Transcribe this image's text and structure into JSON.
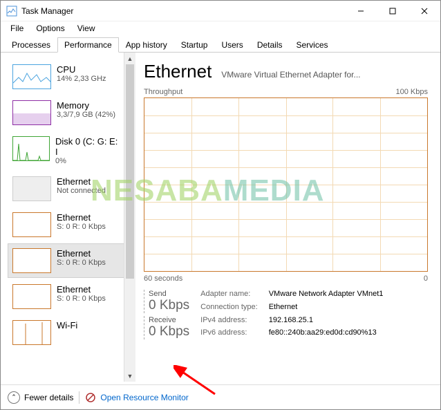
{
  "window": {
    "title": "Task Manager"
  },
  "menu": {
    "file": "File",
    "options": "Options",
    "view": "View"
  },
  "tabs": {
    "processes": "Processes",
    "performance": "Performance",
    "apphistory": "App history",
    "startup": "Startup",
    "users": "Users",
    "details": "Details",
    "services": "Services"
  },
  "sidebar": {
    "items": [
      {
        "title": "CPU",
        "sub": "14% 2,33 GHz",
        "color": "#4aa3df"
      },
      {
        "title": "Memory",
        "sub": "3,3/7,9 GB (42%)",
        "color": "#8e2ea5"
      },
      {
        "title": "Disk 0 (C: G: E: I",
        "sub": "0%",
        "color": "#3fa535"
      },
      {
        "title": "Ethernet",
        "sub": "Not connected",
        "color": "#bbbbbb"
      },
      {
        "title": "Ethernet",
        "sub": "S: 0 R: 0 Kbps",
        "color": "#c9772b"
      },
      {
        "title": "Ethernet",
        "sub": "S: 0 R: 0 Kbps",
        "color": "#c9772b"
      },
      {
        "title": "Ethernet",
        "sub": "S: 0 R: 0 Kbps",
        "color": "#c9772b"
      },
      {
        "title": "Wi-Fi",
        "sub": "",
        "color": "#c9772b"
      }
    ]
  },
  "main": {
    "title": "Ethernet",
    "subtitle": "VMware Virtual Ethernet Adapter for...",
    "chart_top_left": "Throughput",
    "chart_top_right": "100 Kbps",
    "chart_bottom_left": "60 seconds",
    "chart_bottom_right": "0",
    "send_label": "Send",
    "send_value": "0 Kbps",
    "receive_label": "Receive",
    "receive_value": "0 Kbps",
    "info": {
      "adapter_k": "Adapter name:",
      "adapter_v": "VMware Network Adapter VMnet1",
      "conn_k": "Connection type:",
      "conn_v": "Ethernet",
      "ipv4_k": "IPv4 address:",
      "ipv4_v": "192.168.25.1",
      "ipv6_k": "IPv6 address:",
      "ipv6_v": "fe80::240b:aa29:ed0d:cd90%13"
    }
  },
  "footer": {
    "fewer": "Fewer details",
    "orm": "Open Resource Monitor"
  },
  "chart_data": {
    "type": "line",
    "title": "Throughput",
    "series": [
      {
        "name": "Send",
        "values": [
          0,
          0,
          0,
          0,
          0,
          0,
          0,
          0,
          0,
          0,
          0,
          0
        ]
      },
      {
        "name": "Receive",
        "values": [
          0,
          0,
          0,
          0,
          0,
          0,
          0,
          0,
          0,
          0,
          0,
          0
        ]
      }
    ],
    "xlabel": "60 seconds",
    "ylabel": "Kbps",
    "ylim": [
      0,
      100
    ]
  }
}
